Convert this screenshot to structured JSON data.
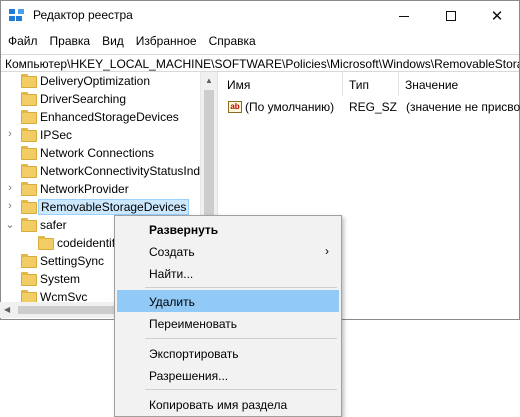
{
  "window": {
    "title": "Редактор реестра",
    "icon": "regedit-icon"
  },
  "menu": [
    "Файл",
    "Правка",
    "Вид",
    "Избранное",
    "Справка"
  ],
  "address": "Компьютер\\HKEY_LOCAL_MACHINE\\SOFTWARE\\Policies\\Microsoft\\Windows\\RemovableStora",
  "tree": [
    {
      "label": "DeliveryOptimization",
      "chevron": ""
    },
    {
      "label": "DriverSearching",
      "chevron": ""
    },
    {
      "label": "EnhancedStorageDevices",
      "chevron": ""
    },
    {
      "label": "IPSec",
      "chevron": "›"
    },
    {
      "label": "Network Connections",
      "chevron": ""
    },
    {
      "label": "NetworkConnectivityStatusInd",
      "chevron": ""
    },
    {
      "label": "NetworkProvider",
      "chevron": "›"
    },
    {
      "label": "RemovableStorageDevices",
      "chevron": "›"
    },
    {
      "label": "safer",
      "chevron": "⌄"
    },
    {
      "label": "codeidentifi",
      "chevron": ""
    },
    {
      "label": "SettingSync",
      "chevron": ""
    },
    {
      "label": "System",
      "chevron": ""
    },
    {
      "label": "WcmSvc",
      "chevron": ""
    }
  ],
  "columns": {
    "name": "Имя",
    "type": "Тип",
    "value": "Значение"
  },
  "rows": [
    {
      "name": "(По умолчанию)",
      "type": "REG_SZ",
      "value": "(значение не присво"
    }
  ],
  "context_menu": [
    {
      "label": "Развернуть",
      "bold": true
    },
    {
      "label": "Создать",
      "submenu": "›"
    },
    {
      "label": "Найти..."
    },
    {
      "label": "Удалить",
      "highlighted": true
    },
    {
      "label": "Переименовать"
    },
    {
      "label": "Экспортировать"
    },
    {
      "label": "Разрешения..."
    },
    {
      "label": "Копировать имя раздела"
    }
  ],
  "colors": {
    "selection": "#cce8ff",
    "menu_highlight": "#91c9f7",
    "folder": "#f2cd66"
  }
}
